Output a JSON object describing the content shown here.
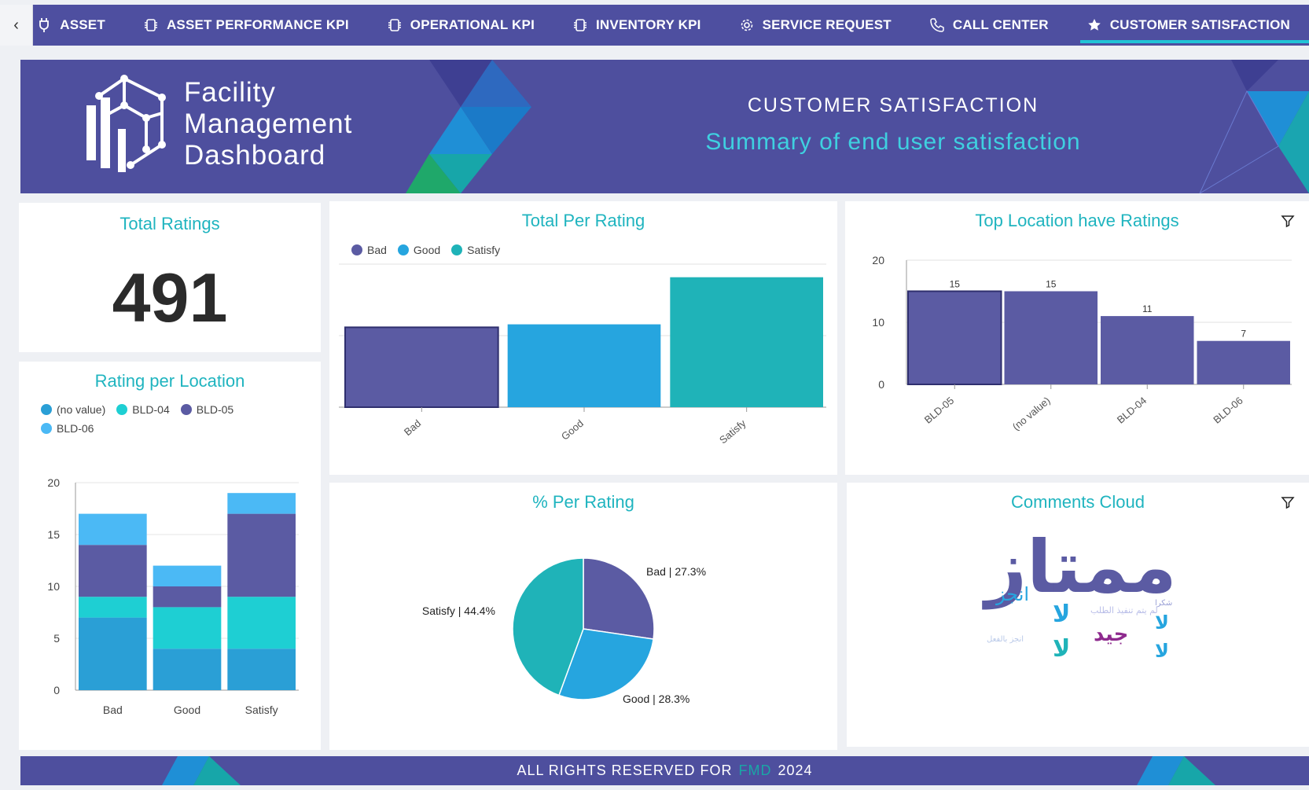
{
  "nav": {
    "tabs": [
      {
        "label": "ASSET",
        "icon": "plug-icon"
      },
      {
        "label": "ASSET PERFORMANCE KPI",
        "icon": "chip-icon"
      },
      {
        "label": "OPERATIONAL KPI",
        "icon": "chip-icon"
      },
      {
        "label": "INVENTORY KPI",
        "icon": "chip-icon"
      },
      {
        "label": "SERVICE REQUEST",
        "icon": "gear-icon"
      },
      {
        "label": "CALL CENTER",
        "icon": "phone-icon"
      },
      {
        "label": "CUSTOMER SATISFACTION",
        "icon": "star-icon",
        "active": true
      }
    ]
  },
  "header": {
    "logo_line1": "Facility",
    "logo_line2": "Management",
    "logo_line3": "Dashboard",
    "title": "CUSTOMER SATISFACTION",
    "subtitle": "Summary of end user satisfaction"
  },
  "total_ratings": {
    "title": "Total Ratings",
    "value": "491"
  },
  "colors": {
    "bad": "#5b5ba3",
    "good": "#26a5df",
    "satisfy": "#1fb3b8",
    "no_value": "#2a9fd6",
    "bld04": "#1ecfd3",
    "bld05": "#5b5ba3",
    "bld06": "#4bb9f5",
    "accent": "#1fb4bf",
    "header_bg": "#4e4f9e"
  },
  "charts": {
    "total_per_rating": {
      "title": "Total Per Rating",
      "legend": [
        "Bad",
        "Good",
        "Satisfy"
      ]
    },
    "top_location": {
      "title": "Top Location have Ratings"
    },
    "rating_per_location": {
      "title": "Rating per Location",
      "legend": [
        "(no value)",
        "BLD-04",
        "BLD-05",
        "BLD-06"
      ]
    },
    "pct_per_rating": {
      "title": "% Per Rating"
    },
    "comments_cloud": {
      "title": "Comments Cloud"
    }
  },
  "chart_data": [
    {
      "type": "bar",
      "title": "Total Per Rating",
      "categories": [
        "Bad",
        "Good",
        "Satisfy"
      ],
      "values": [
        134,
        139,
        218
      ],
      "ylim": [
        0,
        240
      ],
      "legend": "top-left",
      "grid": true
    },
    {
      "type": "bar",
      "title": "Top Location have Ratings",
      "categories": [
        "BLD-05",
        "(no value)",
        "BLD-04",
        "BLD-06"
      ],
      "values": [
        15,
        15,
        11,
        7
      ],
      "data_labels": [
        "15",
        "15",
        "11",
        "7"
      ],
      "yticks": [
        "0",
        "10",
        "20"
      ],
      "ylim": [
        0,
        20
      ],
      "grid": true
    },
    {
      "type": "bar",
      "stacked": true,
      "title": "Rating per Location",
      "categories": [
        "Bad",
        "Good",
        "Satisfy"
      ],
      "series": [
        {
          "name": "(no value)",
          "values": [
            7,
            4,
            4
          ]
        },
        {
          "name": "BLD-04",
          "values": [
            2,
            4,
            5
          ]
        },
        {
          "name": "BLD-05",
          "values": [
            5,
            2,
            8
          ]
        },
        {
          "name": "BLD-06",
          "values": [
            3,
            2,
            2
          ]
        }
      ],
      "yticks": [
        "0",
        "5",
        "10",
        "15",
        "20"
      ],
      "ylim": [
        0,
        20
      ],
      "legend": "top-left",
      "grid": true
    },
    {
      "type": "pie",
      "title": "% Per Rating",
      "labels": [
        "Bad",
        "Good",
        "Satisfy"
      ],
      "values": [
        27.3,
        28.3,
        44.4
      ],
      "data_labels": [
        "Bad | 27.3%",
        "Good | 28.3%",
        "Satisfy | 44.4%"
      ]
    }
  ],
  "word_cloud": {
    "words": [
      {
        "text": "ممتاز",
        "color": "#5b5ba3"
      },
      {
        "text": "انجز",
        "color": "#26a5df"
      },
      {
        "text": "جيد",
        "color": "#8e2a8e"
      },
      {
        "text": "لم يتم تنفيذ الطلب",
        "color": "#b8bde8"
      },
      {
        "text": "شكرا",
        "color": "#9aa0d6"
      },
      {
        "text": "انجز بالفعل",
        "color": "#b8c8e8"
      },
      {
        "text": "لا",
        "color": "#26a5df"
      }
    ]
  },
  "footer": {
    "text_before": "ALL RIGHTS RESERVED FOR",
    "brand": "FMD",
    "year": "2024"
  }
}
